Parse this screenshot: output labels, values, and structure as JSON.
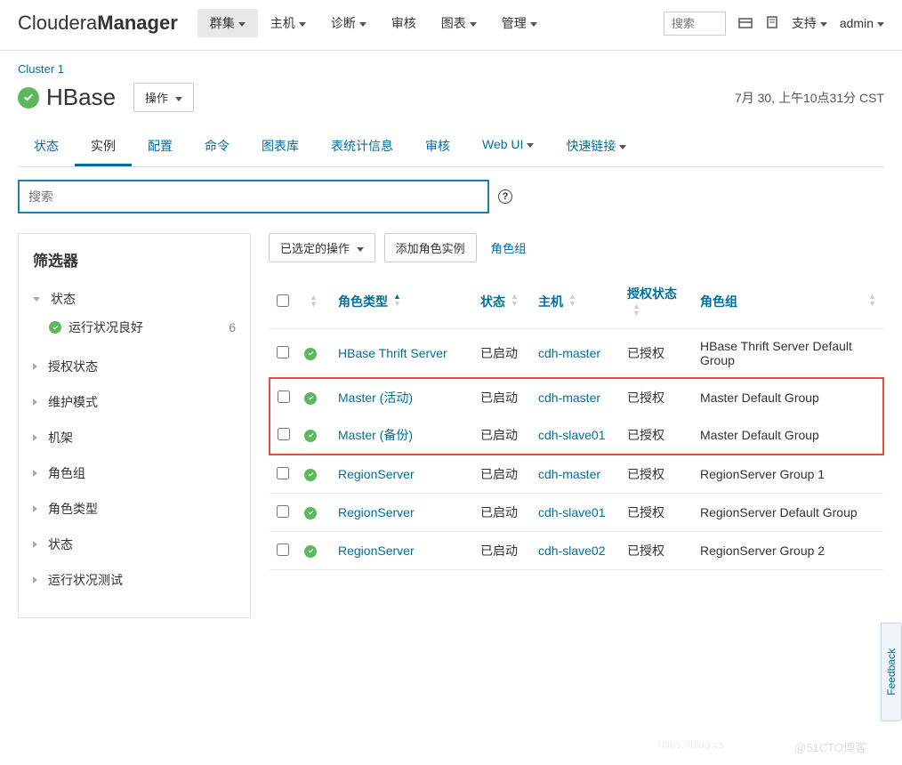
{
  "topbar": {
    "logo_thin": "Cloudera",
    "logo_bold": "Manager",
    "nav": [
      "群集",
      "主机",
      "诊断",
      "审核",
      "图表",
      "管理"
    ],
    "search_placeholder": "搜索",
    "support": "支持",
    "user": "admin"
  },
  "breadcrumb": "Cluster 1",
  "service": {
    "name": "HBase",
    "action_btn": "操作"
  },
  "timestamp": "7月 30, 上午10点31分 CST",
  "tabs": [
    "状态",
    "实例",
    "配置",
    "命令",
    "图表库",
    "表统计信息",
    "审核",
    "Web UI",
    "快速链接"
  ],
  "active_tab_index": 1,
  "search": {
    "placeholder": "搜索"
  },
  "sidebar": {
    "title": "筛选器",
    "groups": [
      {
        "label": "状态",
        "expanded": true,
        "items": [
          {
            "label": "运行状况良好",
            "count": "6"
          }
        ]
      },
      {
        "label": "授权状态",
        "expanded": false
      },
      {
        "label": "维护模式",
        "expanded": false
      },
      {
        "label": "机架",
        "expanded": false
      },
      {
        "label": "角色组",
        "expanded": false
      },
      {
        "label": "角色类型",
        "expanded": false
      },
      {
        "label": "状态",
        "expanded": false
      },
      {
        "label": "运行状况测试",
        "expanded": false
      }
    ]
  },
  "actions": {
    "selected": "已选定的操作",
    "add_role": "添加角色实例",
    "role_group": "角色组"
  },
  "table": {
    "headers": {
      "role_type": "角色类型",
      "status": "状态",
      "host": "主机",
      "auth": "授权状态",
      "group": "角色组"
    },
    "rows": [
      {
        "role": "HBase Thrift Server",
        "status": "已启动",
        "host": "cdh-master",
        "auth": "已授权",
        "group": "HBase Thrift Server Default Group",
        "highlight": false
      },
      {
        "role": "Master (活动)",
        "status": "已启动",
        "host": "cdh-master",
        "auth": "已授权",
        "group": "Master Default Group",
        "highlight": true
      },
      {
        "role": "Master (备份)",
        "status": "已启动",
        "host": "cdh-slave01",
        "auth": "已授权",
        "group": "Master Default Group",
        "highlight": true
      },
      {
        "role": "RegionServer",
        "status": "已启动",
        "host": "cdh-master",
        "auth": "已授权",
        "group": "RegionServer Group 1",
        "highlight": false
      },
      {
        "role": "RegionServer",
        "status": "已启动",
        "host": "cdh-slave01",
        "auth": "已授权",
        "group": "RegionServer Default Group",
        "highlight": false
      },
      {
        "role": "RegionServer",
        "status": "已启动",
        "host": "cdh-slave02",
        "auth": "已授权",
        "group": "RegionServer Group 2",
        "highlight": false
      }
    ]
  },
  "feedback": "Feedback",
  "watermark": "@51CTO博客",
  "watermark2": "https://blog.cs"
}
